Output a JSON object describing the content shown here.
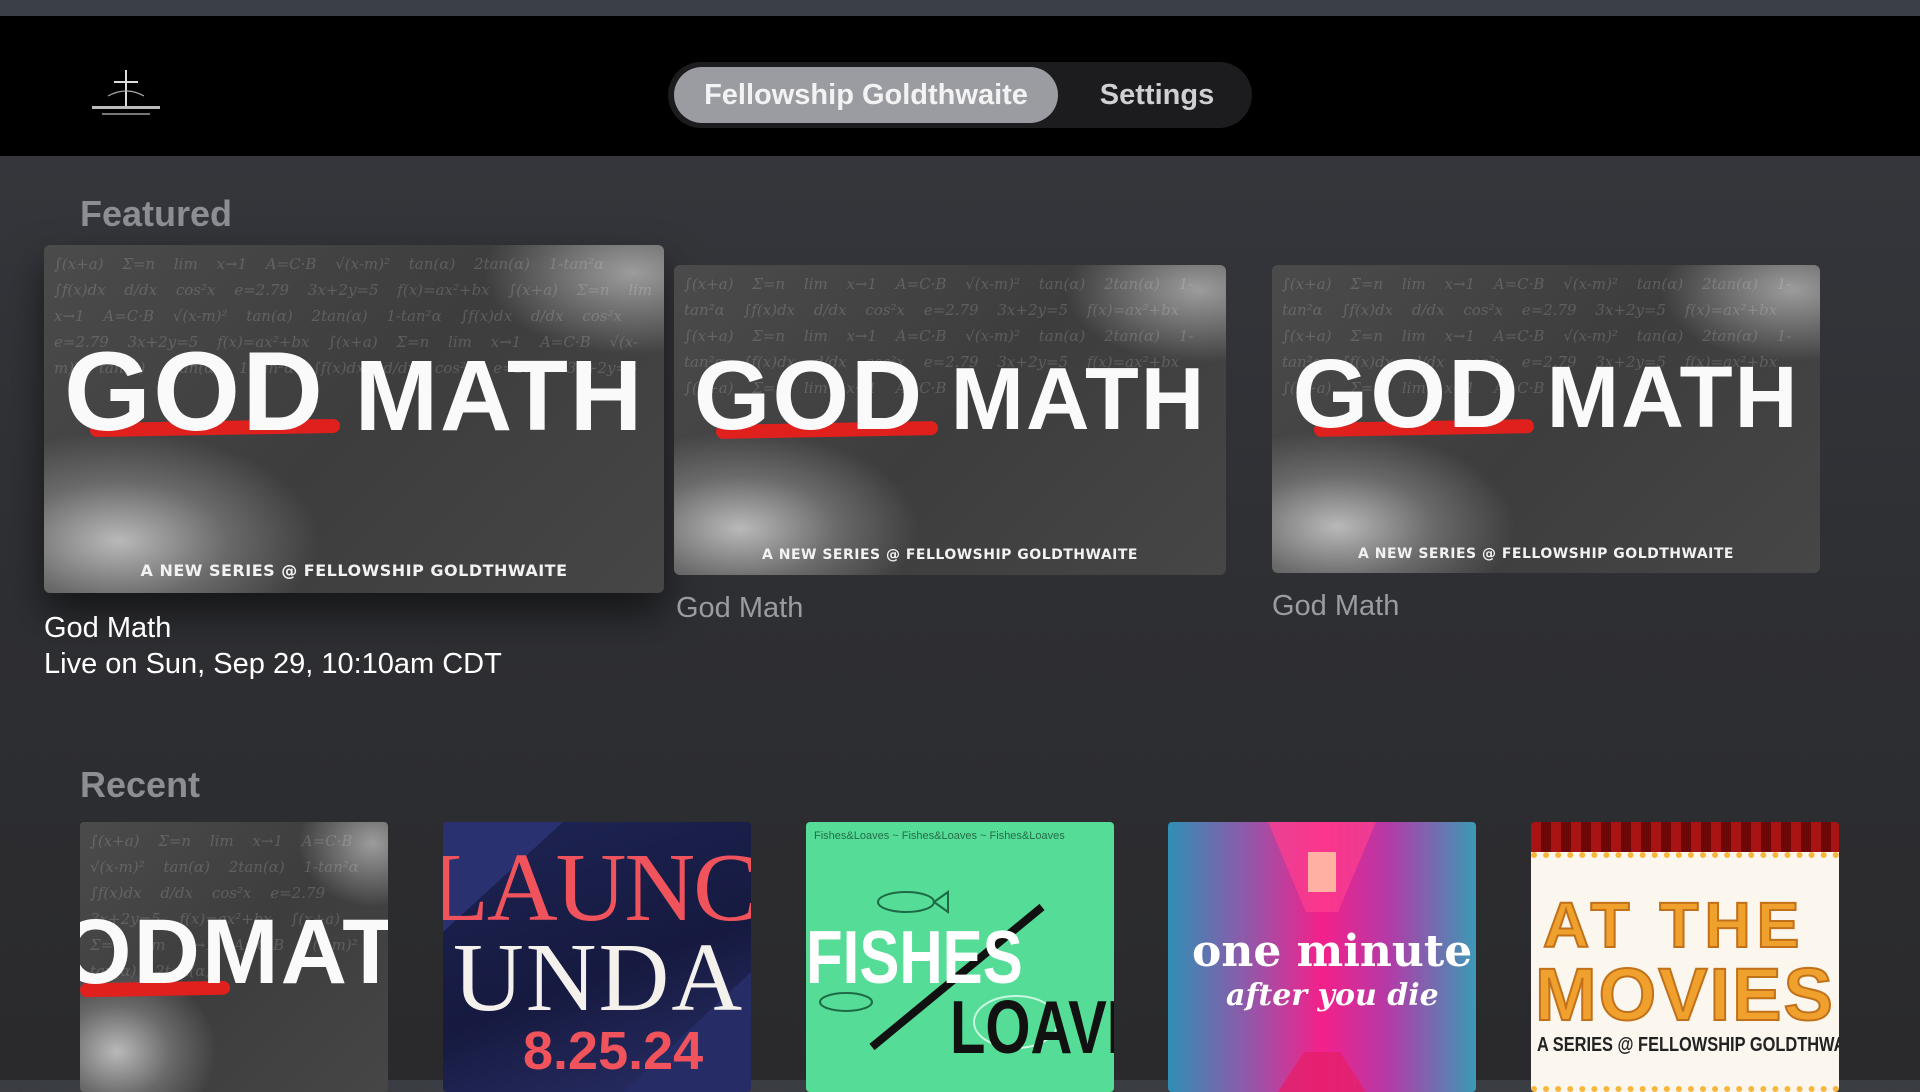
{
  "nav": {
    "tabs": [
      {
        "label": "Fellowship Goldthwaite",
        "selected": true
      },
      {
        "label": "Settings",
        "selected": false
      }
    ],
    "logo_text": "FELLOWSHIP GOLDTHWAITE"
  },
  "featured": {
    "title": "Featured",
    "items": [
      {
        "art_word1": "GOD",
        "art_word2": "MATH",
        "art_sub": "A NEW SERIES @ FELLOWSHIP GOLDTHWAITE",
        "title": "God Math",
        "subtitle": "Live on Sun, Sep 29, 10:10am CDT",
        "focused": true
      },
      {
        "art_word1": "GOD",
        "art_word2": "MATH",
        "art_sub": "A NEW SERIES @ FELLOWSHIP GOLDTHWAITE",
        "title": "God Math",
        "focused": false
      },
      {
        "art_word1": "GOD",
        "art_word2": "MATH",
        "art_sub": "A NEW SERIES @ FELLOWSHIP GOLDTHWAITE",
        "title": "God Math",
        "focused": false
      }
    ]
  },
  "recent": {
    "title": "Recent",
    "items": [
      {
        "art_text": "ODMAT"
      },
      {
        "art_line1": "LAUNC",
        "art_line2": "UNDA",
        "art_date": "8.25.24"
      },
      {
        "art_header": "Fishes&Loaves",
        "art_word1": "FISHES",
        "art_word2": "LOAVES"
      },
      {
        "art_line1": "one minute",
        "art_line2": "after you die"
      },
      {
        "art_line1": "AT THE",
        "art_line2": "MOVIES",
        "art_sub": "A SERIES @ FELLOWSHIP GOLDTHWAITE"
      }
    ]
  },
  "colors": {
    "accent_red": "#e0201d",
    "fishes_green": "#55dc96",
    "movies_gold": "#f6b73c",
    "launch_red": "#f0535c"
  }
}
